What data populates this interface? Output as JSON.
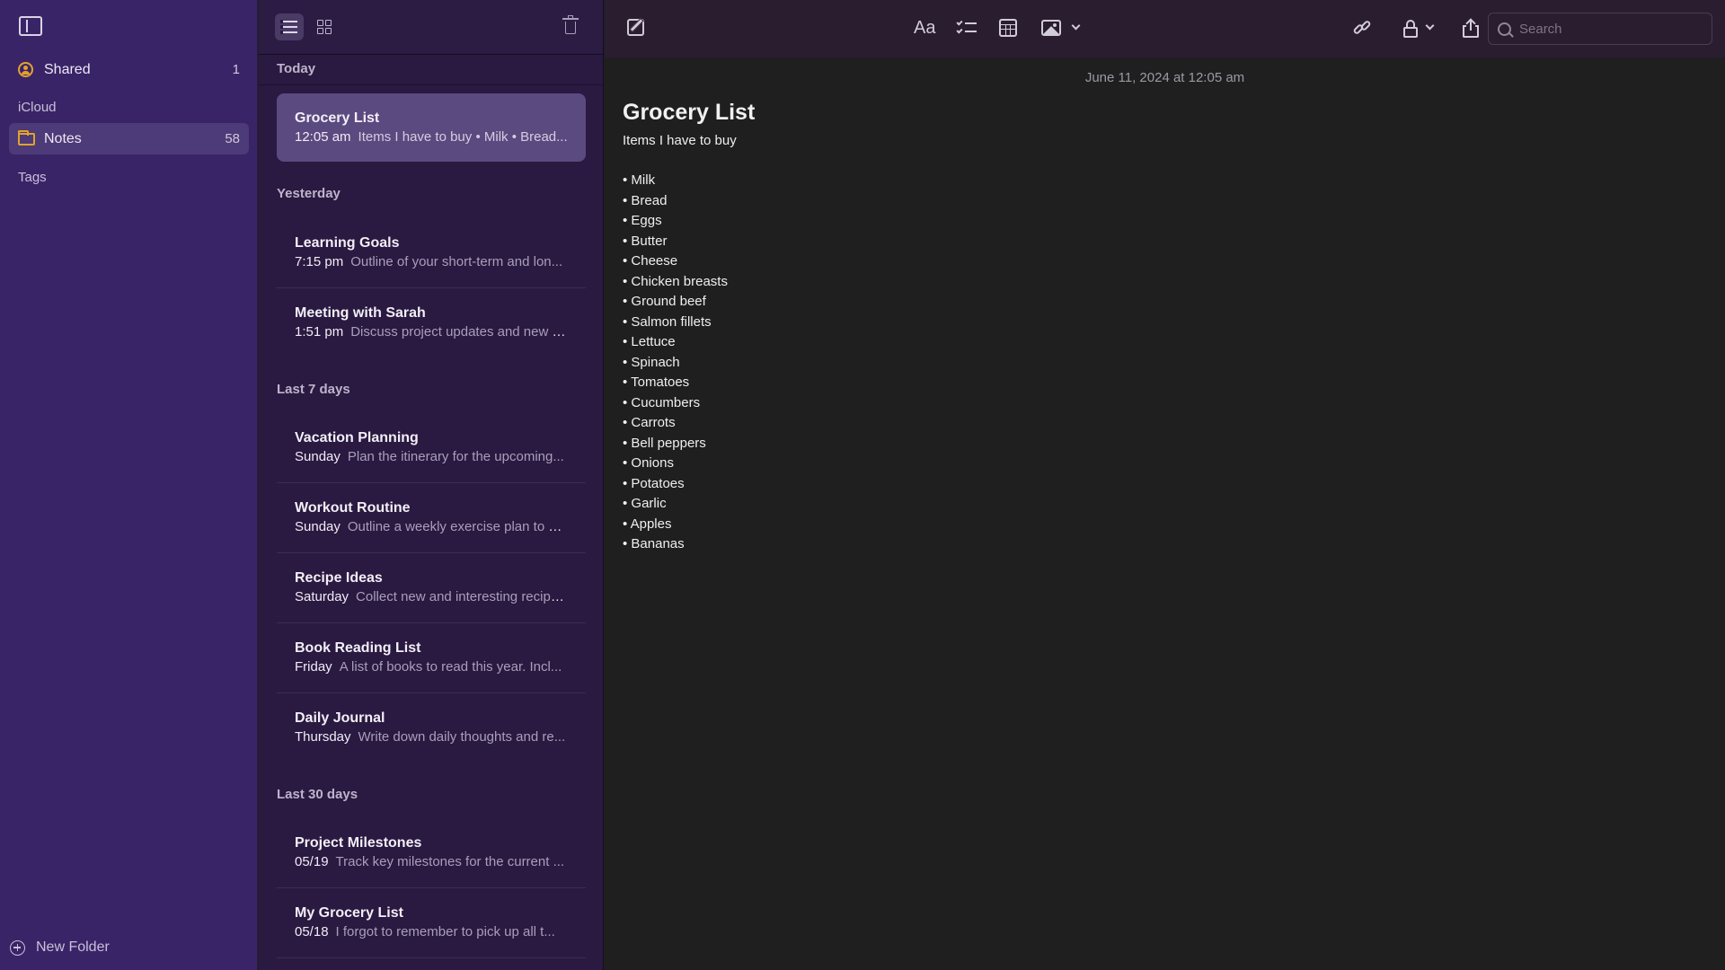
{
  "sidebar": {
    "shared": {
      "label": "Shared",
      "count": "1"
    },
    "icloud_label": "iCloud",
    "notes_folder": {
      "label": "Notes",
      "count": "58"
    },
    "tags_label": "Tags",
    "new_folder_label": "New Folder"
  },
  "note_list": {
    "groups": [
      {
        "label": "Today"
      },
      {
        "label": "Yesterday"
      },
      {
        "label": "Last 7 days"
      },
      {
        "label": "Last 30 days"
      }
    ],
    "notes": [
      {
        "title": "Grocery List",
        "time": "12:05 am",
        "preview": "Items I have to buy • Milk • Bread..."
      },
      {
        "title": "Learning Goals",
        "time": "7:15 pm",
        "preview": "Outline of your short-term and lon..."
      },
      {
        "title": "Meeting with Sarah",
        "time": "1:51 pm",
        "preview": "Discuss project updates and new d..."
      },
      {
        "title": "Vacation Planning",
        "time": "Sunday",
        "preview": "Plan the itinerary for the upcoming..."
      },
      {
        "title": "Workout Routine",
        "time": "Sunday",
        "preview": "Outline a weekly exercise plan to st..."
      },
      {
        "title": "Recipe Ideas",
        "time": "Saturday",
        "preview": "Collect new and interesting recipe..."
      },
      {
        "title": "Book Reading List",
        "time": "Friday",
        "preview": "A list of books to read this year. Incl..."
      },
      {
        "title": "Daily Journal",
        "time": "Thursday",
        "preview": "Write down daily thoughts and re..."
      },
      {
        "title": "Project Milestones",
        "time": "05/19",
        "preview": "Track key milestones for the current ..."
      },
      {
        "title": "My Grocery List",
        "time": "05/18",
        "preview": "I forgot to remember to pick up all t..."
      }
    ]
  },
  "toolbar": {
    "format_label": "Aa",
    "search_placeholder": "Search"
  },
  "note": {
    "date": "June 11, 2024 at 12:05 am",
    "title": "Grocery List",
    "subtitle": "Items I have to buy",
    "items": [
      "• Milk",
      "• Bread",
      "• Eggs",
      "• Butter",
      "• Cheese",
      "• Chicken breasts",
      "• Ground beef",
      "• Salmon fillets",
      "• Lettuce",
      "• Spinach",
      "• Tomatoes",
      "• Cucumbers",
      "• Carrots",
      "• Bell peppers",
      "• Onions",
      "• Potatoes",
      "• Garlic",
      "• Apples",
      "• Bananas"
    ]
  },
  "colors": {
    "sidebar_bg": "#3a2468",
    "list_bg": "#2a1940",
    "selected_note": "#5b4a80",
    "accent_folder": "#e3a22e",
    "editor_bg": "#1f1f1f"
  }
}
